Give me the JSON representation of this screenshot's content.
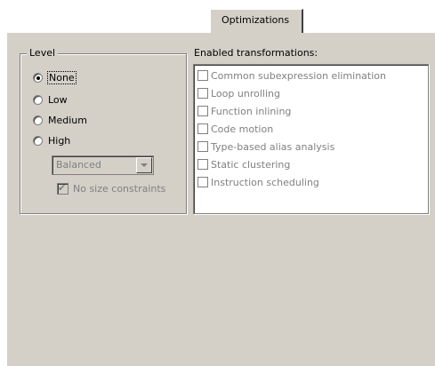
{
  "tab": {
    "label": "Optimizations"
  },
  "level": {
    "legend": "Level",
    "options": [
      {
        "label": "None",
        "checked": true,
        "focused": true
      },
      {
        "label": "Low",
        "checked": false
      },
      {
        "label": "Medium",
        "checked": false
      },
      {
        "label": "High",
        "checked": false
      }
    ],
    "dropdown_value": "Balanced",
    "no_size_constraints_label": "No size constraints",
    "no_size_constraints_checked": true
  },
  "transformations": {
    "label": "Enabled transformations:",
    "items": [
      {
        "label": "Common subexpression elimination",
        "checked": false
      },
      {
        "label": "Loop unrolling",
        "checked": false
      },
      {
        "label": "Function inlining",
        "checked": false
      },
      {
        "label": "Code motion",
        "checked": false
      },
      {
        "label": "Type-based alias analysis",
        "checked": false
      },
      {
        "label": "Static clustering",
        "checked": false
      },
      {
        "label": "Instruction scheduling",
        "checked": false
      }
    ]
  }
}
